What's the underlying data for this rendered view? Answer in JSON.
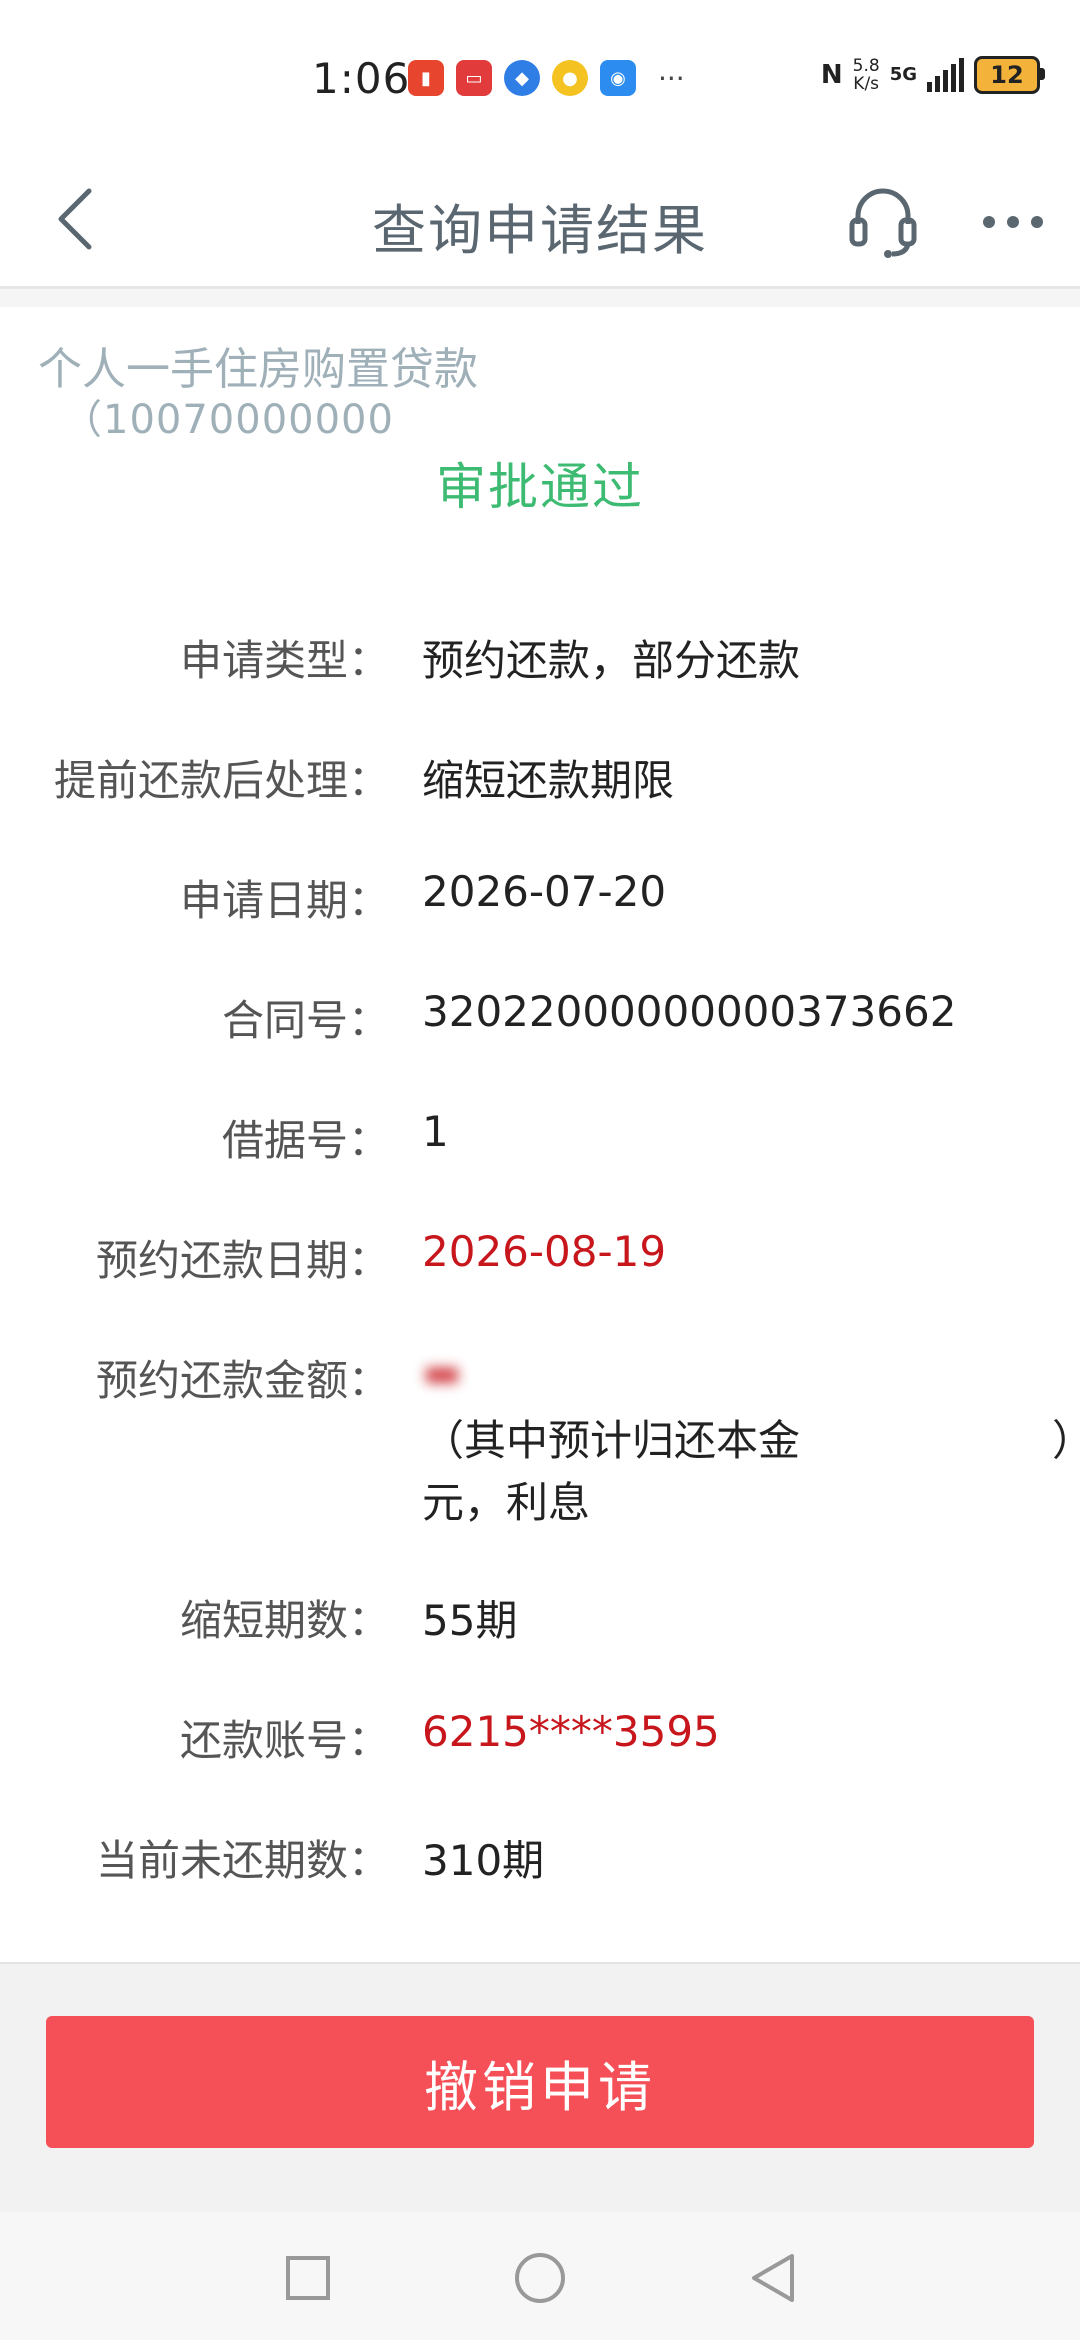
{
  "status_bar": {
    "time": "1:06",
    "net_speed_value": "5.8",
    "net_speed_unit": "K/s",
    "network": "5G",
    "battery": "12",
    "more": "···",
    "nfc": "N"
  },
  "header": {
    "title": "查询申请结果"
  },
  "loan": {
    "name": "个人一手住房购置贷款",
    "id_visible": "（10070000000"
  },
  "status": "审批通过",
  "details": [
    {
      "label": "申请类型：",
      "value": "预约还款，部分还款"
    },
    {
      "label": "提前还款后处理：",
      "value": "缩短还款期限"
    },
    {
      "label": "申请日期：",
      "value": "2026-07-20"
    },
    {
      "label": "合同号：",
      "value": "32022000000000373662"
    },
    {
      "label": "借据号：",
      "value": "1"
    },
    {
      "label": "预约还款日期：",
      "value": "2026-08-19"
    },
    {
      "label": "预约还款金额：",
      "value_line2": "（其中预计归还本金",
      "value_line2_end": "）",
      "value_line3": "元，利息"
    },
    {
      "label": "缩短期数：",
      "value": "55期"
    },
    {
      "label": "还款账号：",
      "value": "6215****3595"
    },
    {
      "label": "当前未还期数：",
      "value": "310期"
    }
  ],
  "actions": {
    "cancel_label": "撤销申请"
  },
  "colors": {
    "approved": "#3dbb72",
    "highlight_red": "#c8161d",
    "cancel_button": "#f55057"
  }
}
